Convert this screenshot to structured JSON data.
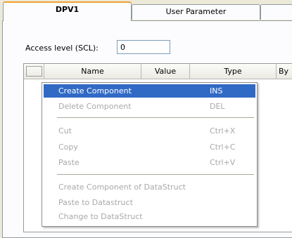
{
  "tabs": [
    {
      "label": "DPV1"
    },
    {
      "label": "User Parameter"
    },
    {
      "label": ""
    }
  ],
  "access": {
    "label": "Access level (SCL):",
    "value": "0"
  },
  "grid": {
    "columns": [
      "",
      "Name",
      "Value",
      "Type",
      "By"
    ]
  },
  "context_menu": {
    "items": [
      {
        "label": "Create Component",
        "shortcut": "INS",
        "state": "highlighted"
      },
      {
        "label": "Delete Component",
        "shortcut": "DEL",
        "state": "disabled"
      },
      {
        "label": "Cut",
        "shortcut": "Ctrl+X",
        "state": "disabled"
      },
      {
        "label": "Copy",
        "shortcut": "Ctrl+C",
        "state": "disabled"
      },
      {
        "label": "Paste",
        "shortcut": "Ctrl+V",
        "state": "disabled"
      },
      {
        "label": "Create Component of DataStruct",
        "shortcut": "",
        "state": "disabled"
      },
      {
        "label": "Paste to Datastruct",
        "shortcut": "",
        "state": "disabled"
      },
      {
        "label": "Change to DataStruct",
        "shortcut": "",
        "state": "disabled"
      }
    ]
  },
  "colors": {
    "highlight": "#316ac5",
    "disabled_text": "#a9a9a9",
    "tab_active_accent": "#f3a12f",
    "window_bg": "#ece9d8"
  }
}
